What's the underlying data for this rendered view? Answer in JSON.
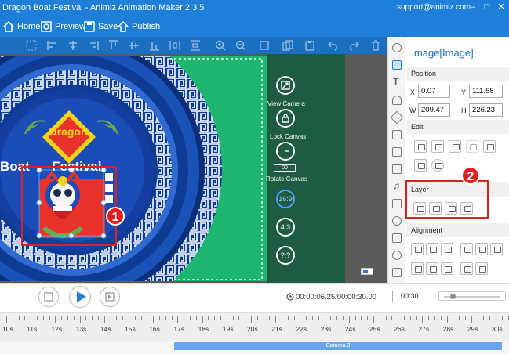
{
  "window": {
    "title": "Dragon Boat Festival - Animiz Animation Maker 2.3.5",
    "email": "support@animiz.com",
    "accent_color": "#1e7fd8"
  },
  "menu": {
    "home": "Home",
    "preview": "Preview",
    "save": "Save",
    "publish": "Publish"
  },
  "stage": {
    "dragon_label": "Dragon",
    "festival_line": "Boat      Festival"
  },
  "camera": {
    "view_camera": "View Camera",
    "lock_canvas": "Lock Canvas",
    "rotate_canvas": "Rotate Canvas",
    "rotate_value": "00",
    "ratio_169": "16:9",
    "ratio_43": "4:3",
    "ratio_custom": "?:?"
  },
  "properties": {
    "header": "image[Image]",
    "position_section": "Position",
    "x_label": "X",
    "x_value": "0.07",
    "y_label": "Y",
    "y_value": "111.58",
    "w_label": "W",
    "w_value": "209.47",
    "h_label": "H",
    "h_value": "226.23",
    "edit_section": "Edit",
    "layer_section": "Layer",
    "alignment_section": "Alignment"
  },
  "annotations": {
    "one": "1",
    "two": "2"
  },
  "playback": {
    "time": "00:00:06.25/00:00:30.00",
    "duration": "00:30"
  },
  "timeline": {
    "ticks": [
      "10s",
      "11s",
      "12s",
      "13s",
      "14s",
      "15s",
      "16s",
      "17s",
      "18s",
      "19s",
      "20s",
      "21s",
      "22s",
      "23s",
      "24s",
      "25s",
      "26s",
      "27s",
      "28s",
      "29s",
      "30s"
    ],
    "camera_track": "Camera 3"
  }
}
